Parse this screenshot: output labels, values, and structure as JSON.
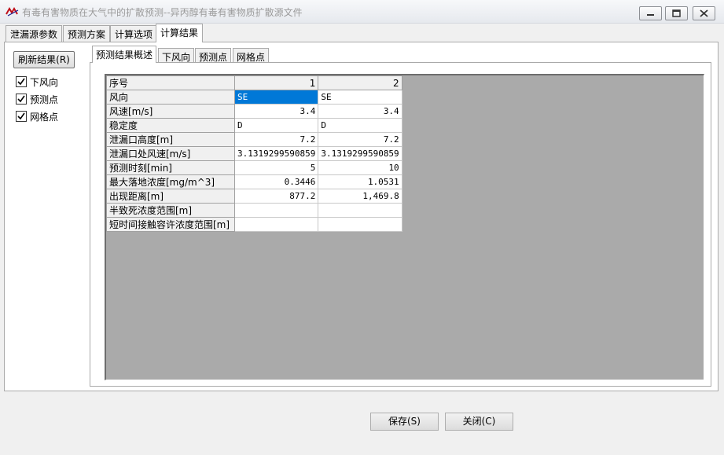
{
  "window": {
    "title": "有毒有害物质在大气中的扩散预测--异丙醇有毒有害物质扩散源文件",
    "accent": "#0078d7"
  },
  "tabs": [
    {
      "label": "泄漏源参数"
    },
    {
      "label": "预测方案"
    },
    {
      "label": "计算选项"
    },
    {
      "label": "计算结果"
    }
  ],
  "selected_tab": "计算结果",
  "left_panel": {
    "refresh_label": "刷新结果(R)",
    "checkboxes": [
      {
        "label": "下风向",
        "checked": true
      },
      {
        "label": "预测点",
        "checked": true
      },
      {
        "label": "网格点",
        "checked": true
      }
    ]
  },
  "inner_tabs": [
    {
      "label": "预测结果概述"
    },
    {
      "label": "下风向"
    },
    {
      "label": "预测点"
    },
    {
      "label": "网格点"
    }
  ],
  "grid": {
    "header": {
      "label": "序号",
      "cols": [
        "1",
        "2"
      ]
    },
    "rows": [
      {
        "label": "风向",
        "values": [
          "SE",
          "SE"
        ]
      },
      {
        "label": "风速[m/s]",
        "values": [
          "3.4",
          "3.4"
        ]
      },
      {
        "label": "稳定度",
        "values": [
          "D",
          "D"
        ]
      },
      {
        "label": "泄漏口高度[m]",
        "values": [
          "7.2",
          "7.2"
        ]
      },
      {
        "label": "泄漏口处风速[m/s]",
        "values": [
          "3.1319299590859",
          "3.1319299590859"
        ]
      },
      {
        "label": "预测时刻[min]",
        "values": [
          "5",
          "10"
        ]
      },
      {
        "label": "最大落地浓度[mg/m^3]",
        "values": [
          "0.3446",
          "1.0531"
        ]
      },
      {
        "label": "出现距离[m]",
        "values": [
          "877.2",
          "1,469.8"
        ]
      },
      {
        "label": "半致死浓度范围[m]",
        "values": [
          "",
          ""
        ]
      },
      {
        "label": "短时间接触容许浓度范围[m]",
        "values": [
          "",
          ""
        ]
      }
    ]
  },
  "footer": {
    "save_label": "保存(S)",
    "close_label": "关闭(C)"
  }
}
